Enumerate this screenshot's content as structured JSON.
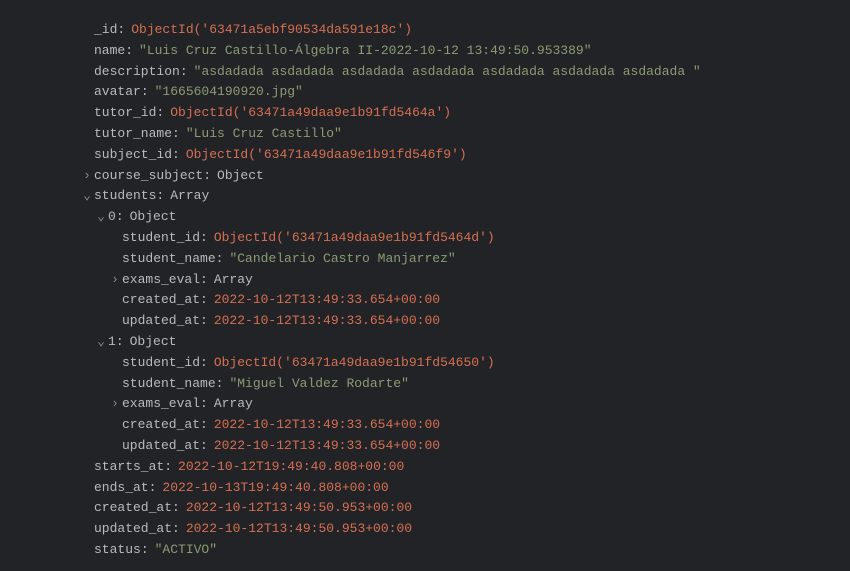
{
  "doc": {
    "_id_key": "_id",
    "_id_val": "ObjectId('63471a5ebf90534da591e18c')",
    "name_key": "name",
    "name_val": "\"Luis Cruz Castillo-Álgebra II-2022-10-12 13:49:50.953389\"",
    "description_key": "description",
    "description_val": "\"asdadada asdadada asdadada asdadada asdadada asdadada asdadada \"",
    "avatar_key": "avatar",
    "avatar_val": "\"1665604190920.jpg\"",
    "tutor_id_key": "tutor_id",
    "tutor_id_val": "ObjectId('63471a49daa9e1b91fd5464a')",
    "tutor_name_key": "tutor_name",
    "tutor_name_val": "\"Luis Cruz Castillo\"",
    "subject_id_key": "subject_id",
    "subject_id_val": "ObjectId('63471a49daa9e1b91fd546f9')",
    "course_subject_key": "course_subject",
    "course_subject_type": "Object",
    "students_key": "students",
    "students_type": "Array",
    "starts_at_key": "starts_at",
    "starts_at_val": "2022-10-12T19:49:40.808+00:00",
    "ends_at_key": "ends_at",
    "ends_at_val": "2022-10-13T19:49:40.808+00:00",
    "created_at_key": "created_at",
    "created_at_val": "2022-10-12T13:49:50.953+00:00",
    "updated_at_key": "updated_at",
    "updated_at_val": "2022-10-12T13:49:50.953+00:00",
    "status_key": "status",
    "status_val": "\"ACTIVO\""
  },
  "students": [
    {
      "idx_key": "0",
      "idx_type": "Object",
      "student_id_key": "student_id",
      "student_id_val": "ObjectId('63471a49daa9e1b91fd5464d')",
      "student_name_key": "student_name",
      "student_name_val": "\"Candelario Castro Manjarrez\"",
      "exams_eval_key": "exams_eval",
      "exams_eval_type": "Array",
      "created_at_key": "created_at",
      "created_at_val": "2022-10-12T13:49:33.654+00:00",
      "updated_at_key": "updated_at",
      "updated_at_val": "2022-10-12T13:49:33.654+00:00"
    },
    {
      "idx_key": "1",
      "idx_type": "Object",
      "student_id_key": "student_id",
      "student_id_val": "ObjectId('63471a49daa9e1b91fd54650')",
      "student_name_key": "student_name",
      "student_name_val": "\"Miguel Valdez Rodarte\"",
      "exams_eval_key": "exams_eval",
      "exams_eval_type": "Array",
      "created_at_key": "created_at",
      "created_at_val": "2022-10-12T13:49:33.654+00:00",
      "updated_at_key": "updated_at",
      "updated_at_val": "2022-10-12T13:49:33.654+00:00"
    }
  ],
  "toggles": {
    "collapsed": "›",
    "expanded": "⌄"
  }
}
